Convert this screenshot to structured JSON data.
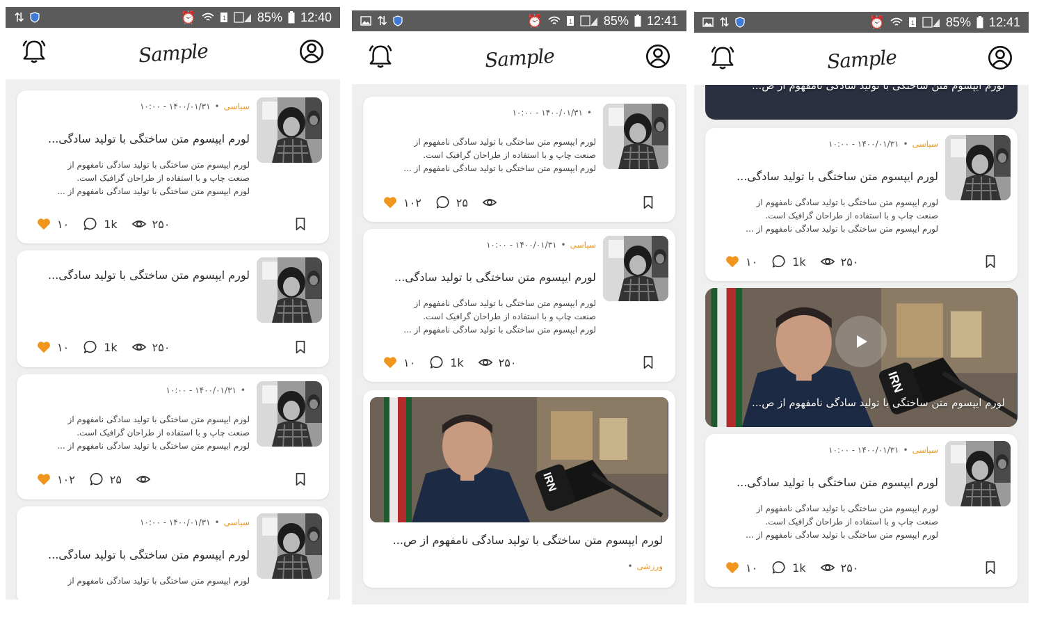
{
  "status_screen1": {
    "battery": "85%",
    "time": "12:40"
  },
  "status_screen2": {
    "battery": "85%",
    "time": "12:41"
  },
  "status_screen3": {
    "battery": "85%",
    "time": "12:41"
  },
  "app": {
    "logo_text": "Sample"
  },
  "post": {
    "category_politics": "سیاسی",
    "category_sports": "ورزشی",
    "date": "۱۴۰۰/۰۱/۳۱ - ۱۰:۰۰",
    "title": "لورم ایپسوم متن ساختگی با تولید سادگی...",
    "excerpt_1": "لورم ایپسوم متن ساختگی با تولید سادگی نامفهوم از",
    "excerpt_2": "صنعت چاپ و با استفاده از طراحان گرافیک است.",
    "excerpt_3": "لورم ایپسوم متن ساختگی با تولید سادگی نامفهوم از ...",
    "video_title": "لورم ایپسوم متن ساختگی با تولید سادگی نامفهوم از ص..."
  },
  "stats_a": {
    "likes": "۱۰",
    "comments": "1k",
    "views": "۲۵۰"
  },
  "stats_b": {
    "likes": "۱۰۲",
    "comments": "۲۵",
    "views": ""
  },
  "icons": {
    "notification": "bell-icon",
    "profile": "user-circle-icon",
    "like": "heart-icon",
    "comment": "comment-icon",
    "views": "eye-icon",
    "save": "bookmark-icon",
    "play": "play-icon"
  },
  "colors": {
    "accent": "#f0961e",
    "status_bar": "#5b5b5b",
    "feed_bg": "#efefef"
  }
}
